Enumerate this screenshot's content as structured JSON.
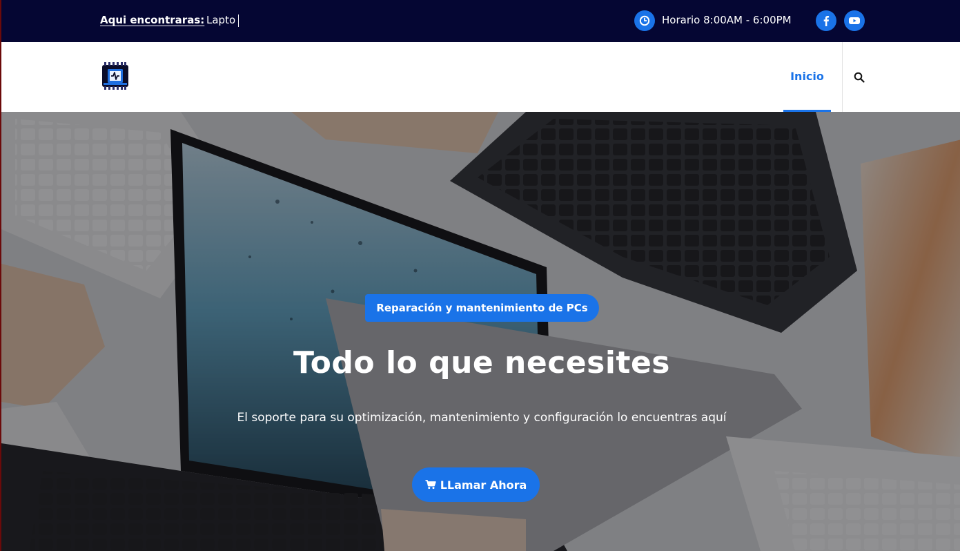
{
  "topbar": {
    "ticker_label": "Aqui encontraras:",
    "ticker_text": "Lapto",
    "hours": "Horario 8:00AM - 6:00PM",
    "icons": {
      "clock": "clock-icon",
      "facebook": "facebook-icon",
      "youtube": "youtube-icon"
    }
  },
  "header": {
    "logo_icon": "chip-logo-icon",
    "nav": [
      {
        "label": "Inicio",
        "active": true
      }
    ],
    "search_icon": "search-icon"
  },
  "hero": {
    "badge": "Reparación y mantenimiento de PCs",
    "title": "Todo lo que necesites",
    "subtitle": "El soporte para su optimización, mantenimiento y configuración lo encuentras aquí",
    "cta_label": "LLamar Ahora",
    "cta_icon": "cart-icon"
  },
  "colors": {
    "topbar_bg": "#050633",
    "accent": "#1a73e8",
    "header_bg": "#ffffff",
    "text_light": "#ffffff"
  }
}
